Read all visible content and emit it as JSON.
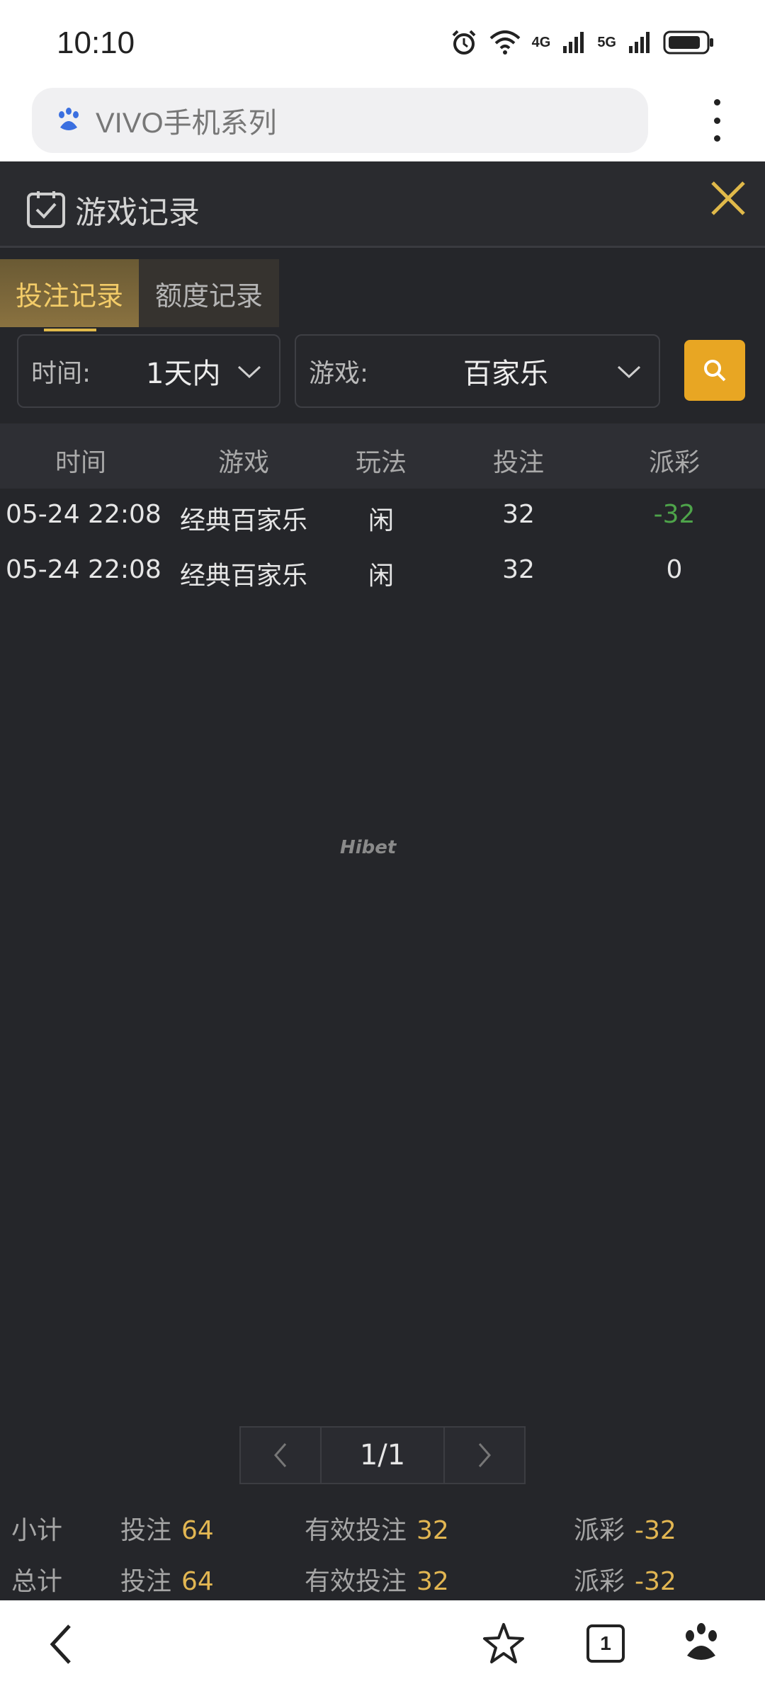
{
  "status_bar": {
    "time": "10:10",
    "net1": "4G",
    "net2": "5G"
  },
  "browser": {
    "url_text": "VIVO手机系列",
    "tab_count": "1"
  },
  "panel": {
    "title": "游戏记录",
    "tabs": [
      {
        "label": "投注记录",
        "active": true
      },
      {
        "label": "额度记录",
        "active": false
      }
    ]
  },
  "filters": {
    "time_label": "时间:",
    "time_value": "1天内",
    "game_label": "游戏:",
    "game_value": "百家乐"
  },
  "table": {
    "headers": [
      "时间",
      "游戏",
      "玩法",
      "投注",
      "派彩"
    ],
    "rows": [
      {
        "time": "05-24 22:08",
        "game": "经典百家乐",
        "play": "闲",
        "bet": "32",
        "payout": "-32"
      },
      {
        "time": "05-24 22:08",
        "game": "经典百家乐",
        "play": "闲",
        "bet": "32",
        "payout": "0"
      }
    ]
  },
  "watermark": "Hibet",
  "pagination": {
    "page": "1/1"
  },
  "summary": {
    "subtotal": {
      "label": "小计",
      "bet_label": "投注",
      "bet_value": "64",
      "valid_label": "有效投注",
      "valid_value": "32",
      "payout_label": "派彩",
      "payout_value": "-32"
    },
    "total": {
      "label": "总计",
      "bet_label": "投注",
      "bet_value": "64",
      "valid_label": "有效投注",
      "valid_value": "32",
      "payout_label": "派彩",
      "payout_value": "-32"
    }
  },
  "colors": {
    "accent_gold": "#e2b652",
    "search_button": "#e8a623",
    "negative": "#4ea44a",
    "background": "#25262a"
  }
}
